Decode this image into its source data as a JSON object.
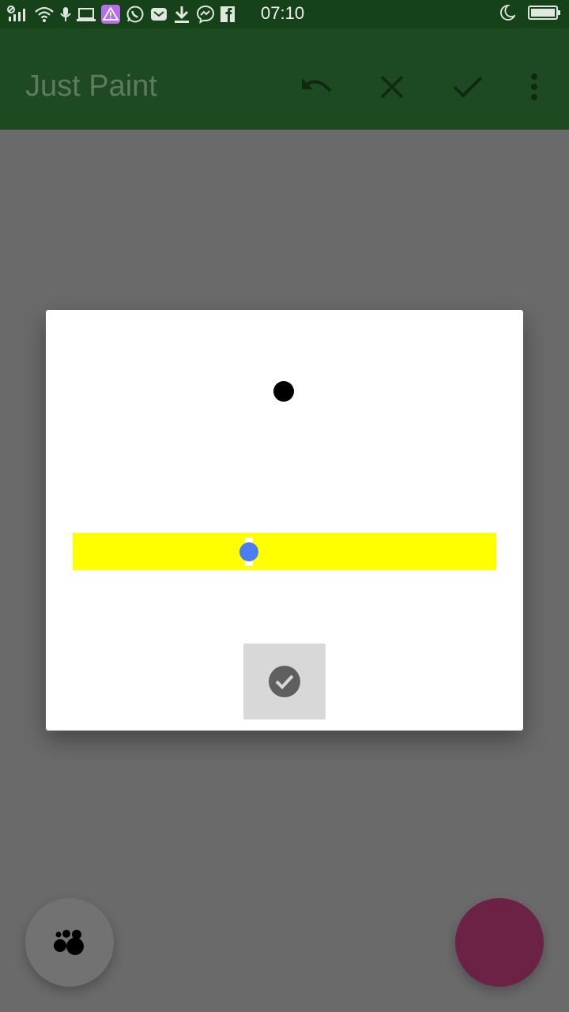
{
  "status_bar": {
    "time": "07:10",
    "icons_left": [
      "signal-icon",
      "wifi-icon",
      "mic-icon",
      "laptop-icon",
      "warning-app-icon",
      "whatsapp-icon",
      "mail-icon",
      "download-icon",
      "messenger-icon",
      "facebook-icon"
    ],
    "icons_right": [
      "moon-icon",
      "battery-icon"
    ]
  },
  "app_bar": {
    "title": "Just Paint",
    "actions": [
      "undo-icon",
      "close-icon",
      "check-icon",
      "more-vert-icon"
    ]
  },
  "dialog": {
    "brush_color": "#000000",
    "slider_track_color": "#ffff00",
    "slider_thumb_color": "#4a7cf2",
    "slider_value_fraction": 0.42,
    "ok_icon": "check-circle-icon"
  },
  "fabs": {
    "left_icon": "brush-dots-icon",
    "right_color": "#6b2244"
  },
  "colors": {
    "status_bar": "#16421a",
    "app_bar": "#1e4a22",
    "canvas_dim": "#6a6a6a"
  }
}
